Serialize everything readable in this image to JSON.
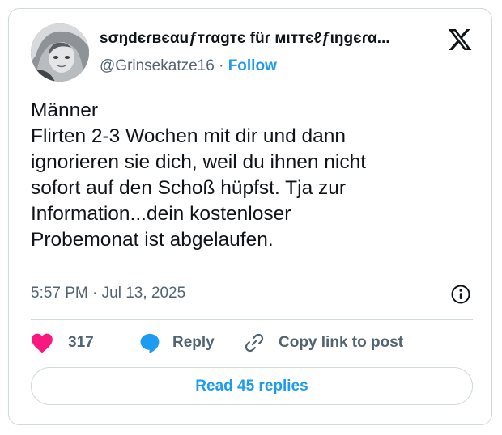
{
  "author": {
    "display_name": "sσŋdєɾвєαuƒтɾαgтє füɾ мιттєℓƒιŋgєɾα...",
    "handle": "@Grinsekatze16",
    "separator": "·",
    "follow_label": "Follow"
  },
  "tweet": {
    "lines": [
      "Männer",
      "Flirten 2-3 Wochen mit dir und dann",
      "ignorieren sie dich, weil du ihnen nicht",
      "sofort auf den Schoß hüpfst. Tja zur",
      "Information...dein kostenloser",
      "Probemonat ist abgelaufen."
    ],
    "time": "5:57 PM",
    "meta_separator": "·",
    "date": "Jul 13, 2025"
  },
  "actions": {
    "like_count": "317",
    "reply_label": "Reply",
    "copy_link_label": "Copy link to post"
  },
  "read_replies_label": "Read 45 replies",
  "icons": {
    "platform": "x-logo-icon",
    "info": "info-icon",
    "like": "heart-icon",
    "reply": "speech-bubble-icon",
    "copy": "link-icon"
  },
  "colors": {
    "accent": "#1d9bf0",
    "like": "#f91880",
    "secondary_text": "#536471",
    "border": "#cfd9de"
  }
}
